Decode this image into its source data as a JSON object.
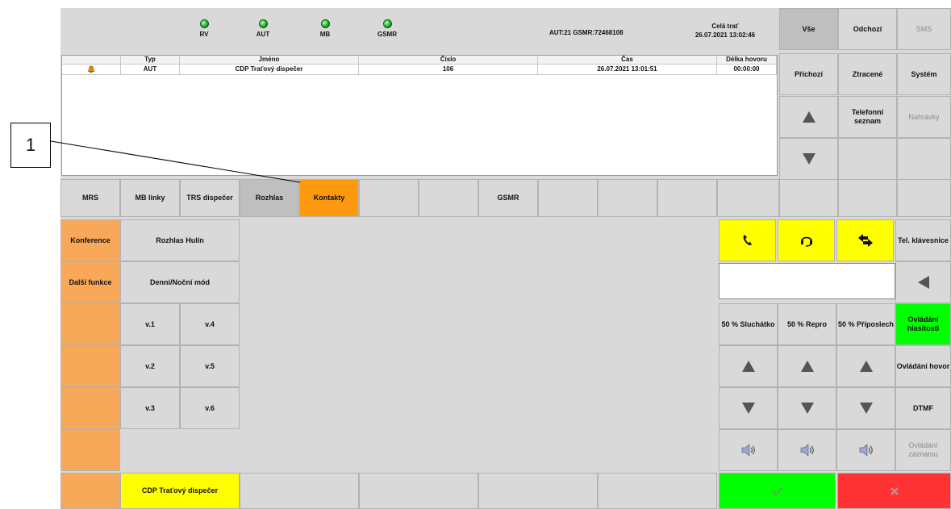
{
  "status_bar": {
    "leds": [
      {
        "label": "RV"
      },
      {
        "label": "AUT"
      },
      {
        "label": "MB"
      },
      {
        "label": "GSMR"
      }
    ],
    "connection_info": "AUT:21 GSMR:72468108",
    "scope_title": "Celá trať",
    "datetime": "26.07.2021 13:02:46"
  },
  "call_table": {
    "columns": [
      "Typ",
      "Jméno",
      "Číslo",
      "Čas",
      "Délka hovoru"
    ],
    "rows": [
      {
        "type": "AUT",
        "name": "CDP Traťový dispečer",
        "number": "106",
        "time": "26.07.2021 13:01:51",
        "duration": "00:00:00"
      }
    ]
  },
  "filters": {
    "all": "Vše",
    "outgoing": "Odchozí",
    "sms": "SMS",
    "incoming": "Příchozí",
    "lost": "Ztracené",
    "system": "Systém",
    "phonebook": "Telefonní seznam",
    "recordings": "Nahrávky"
  },
  "tabs": {
    "mrs": "MRS",
    "mb_lines": "MB linky",
    "trs": "TRS dispečer",
    "rozhlas": "Rozhlas",
    "kontakty": "Kontakty",
    "gsmr": "GSMR"
  },
  "left_panel": {
    "conference": "Konference",
    "more": "Další funkce",
    "rozhlas_hulin": "Rozhlas Hulín",
    "day_night": "Denní/Noční mód",
    "v1": "v.1",
    "v2": "v.2",
    "v3": "v.3",
    "v4": "v.4",
    "v5": "v.5",
    "v6": "v.6",
    "current_call": "CDP Traťový dispečer"
  },
  "right_panel": {
    "keypad": "Tel. klávesnice",
    "vol_handset": "50 % Sluchátko",
    "vol_speaker": "50 % Repro",
    "vol_listen": "50 % Příposlech",
    "volume_control": "Ovládání hlasitosti",
    "call_control": "Ovládání hovor",
    "dtmf": "DTMF",
    "rec_control": "Ovládání záznamu"
  },
  "annotation": {
    "number": "1"
  },
  "colors": {
    "accent_orange": "#ff9a0f",
    "soft_orange": "#f7a858",
    "yellow": "#ffff00",
    "confirm_green": "#00ff00",
    "cancel_red": "#ff3333"
  }
}
